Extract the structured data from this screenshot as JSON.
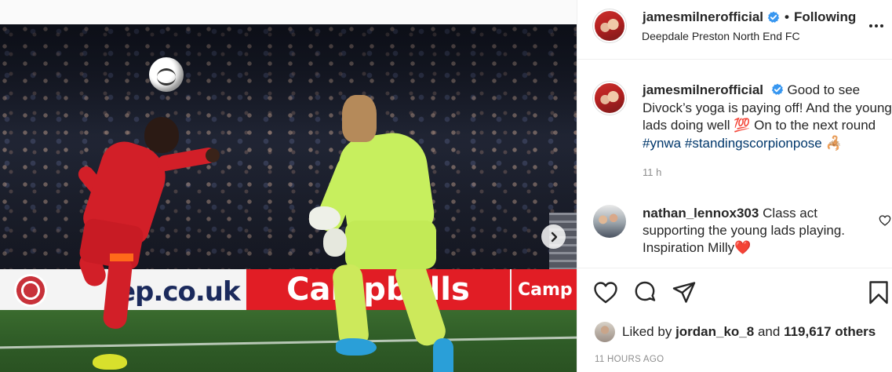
{
  "post": {
    "username": "jamesmilnerofficial",
    "follow_label": "Following",
    "separator": "•",
    "location": "Deepdale Preston North End FC",
    "caption": {
      "text_before": "Good to see Divock’s yoga is paying off! And the young lads doing well 💯 On to the next round ",
      "hashtags": [
        "#ynwa",
        "#standingscorpionpose"
      ],
      "text_after": " 🦂",
      "time": "11 h"
    },
    "comments": [
      {
        "username": "nathan_lennox303",
        "text": "Class act supporting the young lads playing. Inspiration Milly❤️"
      }
    ],
    "likes": {
      "prefix": "Liked by",
      "liker": "jordan_ko_8",
      "connector": "and",
      "others": "119,617 others"
    },
    "timestamp": "11 HOURS AGO"
  },
  "photo": {
    "ad_left_text": "ep.co.uk",
    "ad_center_text": "Campbells",
    "ad_right_text": "Camp"
  },
  "icons": {
    "verified": "verified-badge-icon",
    "more": "more-options-icon",
    "like": "heart-icon",
    "comment": "comment-bubble-icon",
    "share": "paper-plane-icon",
    "save": "bookmark-icon",
    "next": "chevron-right-icon"
  },
  "colors": {
    "verified_blue": "#3897f0",
    "hashtag": "#00376b",
    "muted_text": "#8e8e8e",
    "heart_red": "#ed4956"
  }
}
